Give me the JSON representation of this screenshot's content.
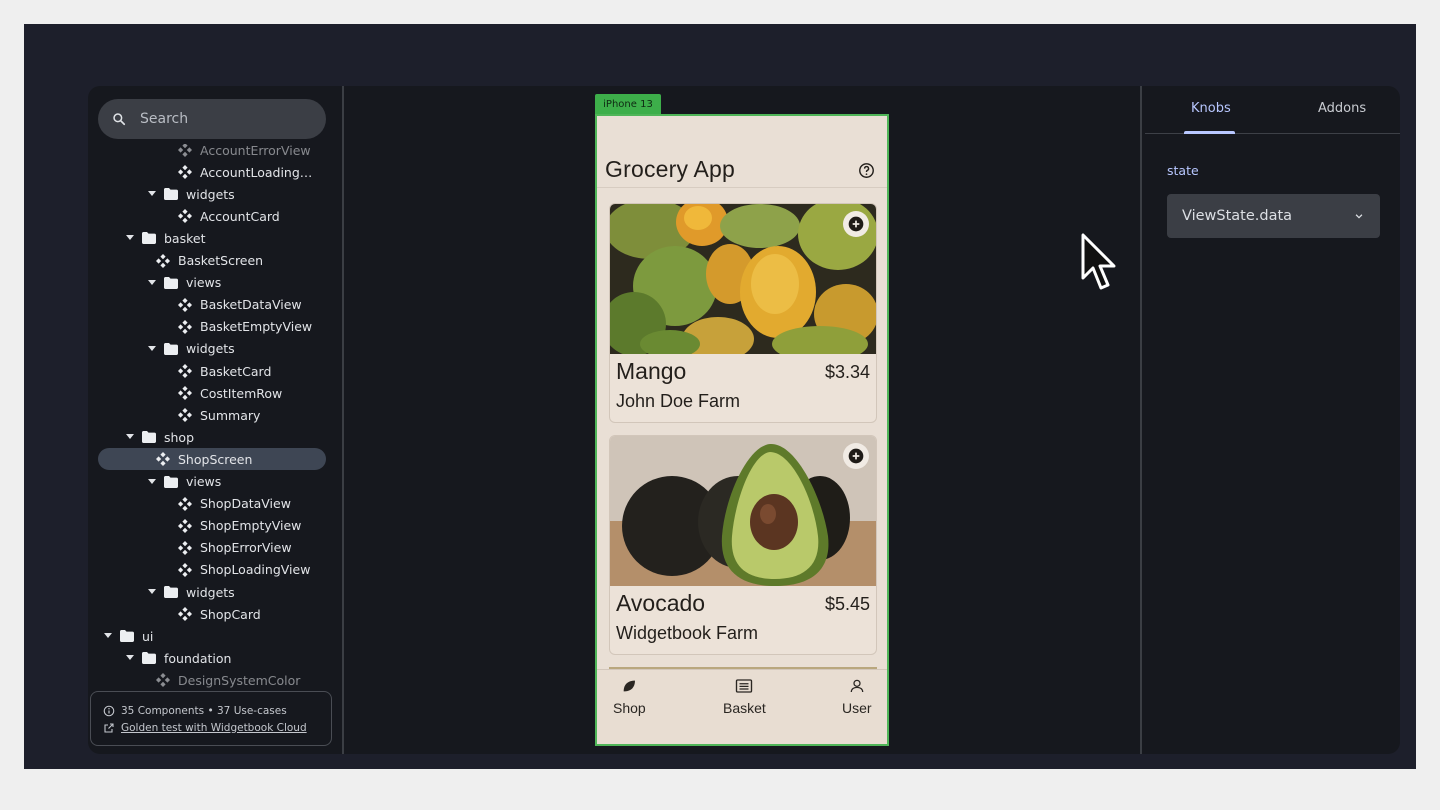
{
  "search": {
    "placeholder": "Search"
  },
  "tree": [
    {
      "label": "AccountErrorView",
      "depth": 4,
      "kind": "component",
      "partial": true
    },
    {
      "label": "AccountLoading…",
      "depth": 4,
      "kind": "component"
    },
    {
      "label": "widgets",
      "depth": 3,
      "kind": "folder"
    },
    {
      "label": "AccountCard",
      "depth": 4,
      "kind": "component"
    },
    {
      "label": "basket",
      "depth": 2,
      "kind": "folder"
    },
    {
      "label": "BasketScreen",
      "depth": 3,
      "kind": "component"
    },
    {
      "label": "views",
      "depth": 3,
      "kind": "folder"
    },
    {
      "label": "BasketDataView",
      "depth": 4,
      "kind": "component"
    },
    {
      "label": "BasketEmptyView",
      "depth": 4,
      "kind": "component"
    },
    {
      "label": "widgets",
      "depth": 3,
      "kind": "folder"
    },
    {
      "label": "BasketCard",
      "depth": 4,
      "kind": "component"
    },
    {
      "label": "CostItemRow",
      "depth": 4,
      "kind": "component"
    },
    {
      "label": "Summary",
      "depth": 4,
      "kind": "component"
    },
    {
      "label": "shop",
      "depth": 2,
      "kind": "folder"
    },
    {
      "label": "ShopScreen",
      "depth": 3,
      "kind": "component",
      "selected": true
    },
    {
      "label": "views",
      "depth": 3,
      "kind": "folder"
    },
    {
      "label": "ShopDataView",
      "depth": 4,
      "kind": "component"
    },
    {
      "label": "ShopEmptyView",
      "depth": 4,
      "kind": "component"
    },
    {
      "label": "ShopErrorView",
      "depth": 4,
      "kind": "component"
    },
    {
      "label": "ShopLoadingView",
      "depth": 4,
      "kind": "component"
    },
    {
      "label": "widgets",
      "depth": 3,
      "kind": "folder"
    },
    {
      "label": "ShopCard",
      "depth": 4,
      "kind": "component"
    },
    {
      "label": "ui",
      "depth": 1,
      "kind": "folder"
    },
    {
      "label": "foundation",
      "depth": 2,
      "kind": "folder"
    },
    {
      "label": "DesignSystemColor",
      "depth": 3,
      "kind": "component",
      "partial": true
    }
  ],
  "footer": {
    "stats": "35 Components • 37 Use-cases",
    "link": "Golden test with Widgetbook Cloud"
  },
  "device": {
    "name": "iPhone 13",
    "app_title": "Grocery App",
    "cards": [
      {
        "name": "Mango",
        "price": "$3.34",
        "farm": "John Doe Farm"
      },
      {
        "name": "Avocado",
        "price": "$5.45",
        "farm": "Widgetbook Farm"
      }
    ],
    "nav": {
      "shop": "Shop",
      "basket": "Basket",
      "user": "User"
    }
  },
  "panel": {
    "tabs": {
      "knobs": "Knobs",
      "addons": "Addons"
    },
    "knob_label": "state",
    "knob_value": "ViewState.data"
  },
  "colors": {
    "accent": "#b8c7ff",
    "device_frame": "#4fb558",
    "selected_row": "#3e4654"
  }
}
